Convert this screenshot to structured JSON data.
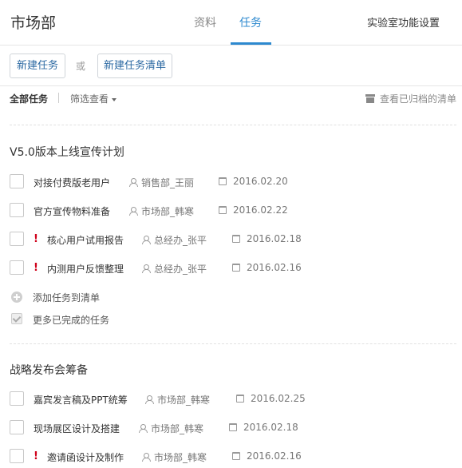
{
  "header": {
    "department": "市场部",
    "tabs": [
      "资料",
      "任务"
    ],
    "active_tab": "任务",
    "settings_label": "实验室功能设置",
    "accent_color": "#2d89cf"
  },
  "toolbar": {
    "new_task_label": "新建任务",
    "or_label": "或",
    "new_list_label": "新建任务清单"
  },
  "filter": {
    "all_tasks_label": "全部任务",
    "filter_label": "筛选查看",
    "archived_label": "查看已归档的清单"
  },
  "lists": [
    {
      "title": "V5.0版本上线宣传计划",
      "tasks": [
        {
          "name": "对接付费版老用户",
          "urgent": false,
          "owner": "销售部_王丽",
          "date": "2016.02.20"
        },
        {
          "name": "官方宣传物料准备",
          "urgent": false,
          "owner": "市场部_韩寒",
          "date": "2016.02.22"
        },
        {
          "name": "核心用户试用报告",
          "urgent": true,
          "owner": "总经办_张平",
          "date": "2016.02.18"
        },
        {
          "name": "内测用户反馈整理",
          "urgent": true,
          "owner": "总经办_张平",
          "date": "2016.02.16"
        }
      ],
      "add_task_label": "添加任务到清单",
      "more_completed_label": "更多已完成的任务"
    },
    {
      "title": "战略发布会筹备",
      "tasks": [
        {
          "name": "嘉宾发言稿及PPT统筹",
          "urgent": false,
          "owner": "市场部_韩寒",
          "date": "2016.02.25"
        },
        {
          "name": "现场展区设计及搭建",
          "urgent": false,
          "owner": "市场部_韩寒",
          "date": "2016.02.18"
        },
        {
          "name": "邀请函设计及制作",
          "urgent": true,
          "owner": "市场部_韩寒",
          "date": "2016.02.16"
        }
      ]
    }
  ],
  "urgent_mark": "!",
  "urgent_color": "#d0021b"
}
